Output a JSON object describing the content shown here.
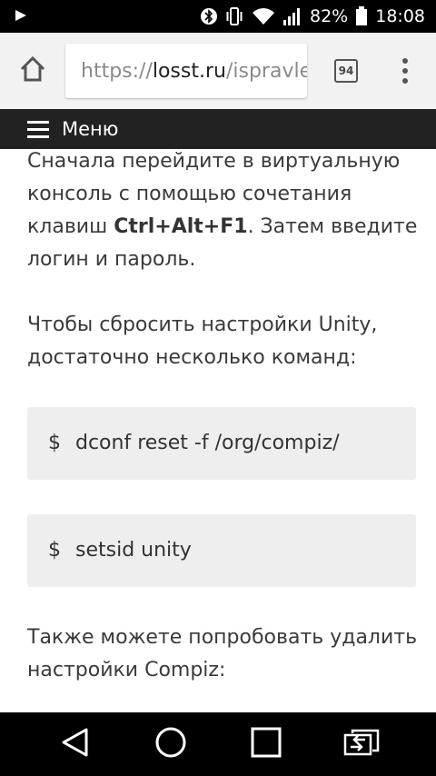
{
  "status_bar": {
    "battery_percent": "82%",
    "time": "18:08"
  },
  "browser": {
    "url_scheme": "https://",
    "url_domain": "losst.ru",
    "url_path": "/ispravle",
    "tab_count": "94"
  },
  "site_menu": {
    "label": "Меню"
  },
  "article": {
    "para1_line1": "Сначала перейдите в виртуальную",
    "para1_line2": "консоль с помощью сочетания",
    "para1_line3_pre": "клавиш ",
    "para1_hotkey": "Ctrl+Alt+F1",
    "para1_line3_post": ". Затем введите",
    "para1_line4": "логин и пароль.",
    "para2_line1": "Чтобы сбросить настройки Unity,",
    "para2_line2": "достаточно несколько команд:",
    "code_prompt": "$",
    "code1": "dconf reset -f /org/compiz/",
    "code2": "setsid unity",
    "para3_line1": "Также можете попробовать удалить",
    "para3_line2": "настройки Compiz:"
  },
  "icons": {
    "play": "play-icon",
    "bluetooth": "bluetooth-icon",
    "vibrate": "vibrate-icon",
    "wifi": "wifi-icon",
    "signal": "signal-icon",
    "battery": "battery-icon",
    "home": "home-icon",
    "tabs": "tabs-icon",
    "overflow": "more-vert-icon",
    "menu": "hamburger-icon",
    "back": "back-icon",
    "home_nav": "home-circle-icon",
    "recents": "recents-icon",
    "cast": "cast-screen-icon"
  }
}
